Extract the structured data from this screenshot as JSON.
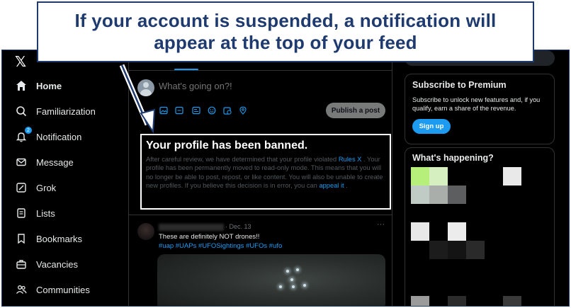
{
  "callout": {
    "line1": "If your account is suspended, a notification will",
    "line2": "appear at the top of your feed"
  },
  "nav": {
    "logo": "𝕏",
    "items": [
      {
        "label": "Home",
        "icon": "home-icon"
      },
      {
        "label": "Familiarization",
        "icon": "search-icon"
      },
      {
        "label": "Notification",
        "icon": "bell-icon",
        "badge": "2"
      },
      {
        "label": "Message",
        "icon": "mail-icon"
      },
      {
        "label": "Grok",
        "icon": "grok-icon"
      },
      {
        "label": "Lists",
        "icon": "list-icon"
      },
      {
        "label": "Bookmarks",
        "icon": "bookmark-icon"
      },
      {
        "label": "Vacancies",
        "icon": "briefcase-icon"
      },
      {
        "label": "Communities",
        "icon": "people-icon"
      }
    ]
  },
  "compose": {
    "placeholder": "What's going on?!",
    "post_button": "Publish a post",
    "tools": [
      "image-icon",
      "gif-icon",
      "poll-icon",
      "emoji-icon",
      "schedule-icon",
      "location-icon"
    ]
  },
  "banned": {
    "title": "Your profile has been banned.",
    "text_1": "After careful review, we have determined that your profile violated ",
    "link_rules": "Rules X",
    "text_2": " . Your profile has been permanently moved to read-only mode. This means that you will no longer be able to post, repost, or like content. You will also be unable to create new profiles. If you believe this decision is in error, you can ",
    "link_appeal": "appeal it",
    "text_3": " ."
  },
  "tweet": {
    "date": "· Dec. 13",
    "more": "···",
    "text": "These are definitely NOT drones!!",
    "tags": "#uap #UAPs #UFOSightings #UFOs #ufo"
  },
  "premium": {
    "title": "Subscribe to Premium",
    "text": "Subscribe to unlock new features and, if you qualify, earn a share of the revenue.",
    "button": "Sign up"
  },
  "happening": {
    "title": "What's happening?"
  },
  "colors": {
    "accent": "#1d9bf0",
    "callout_border": "#1e3a6e",
    "background": "#000000"
  }
}
